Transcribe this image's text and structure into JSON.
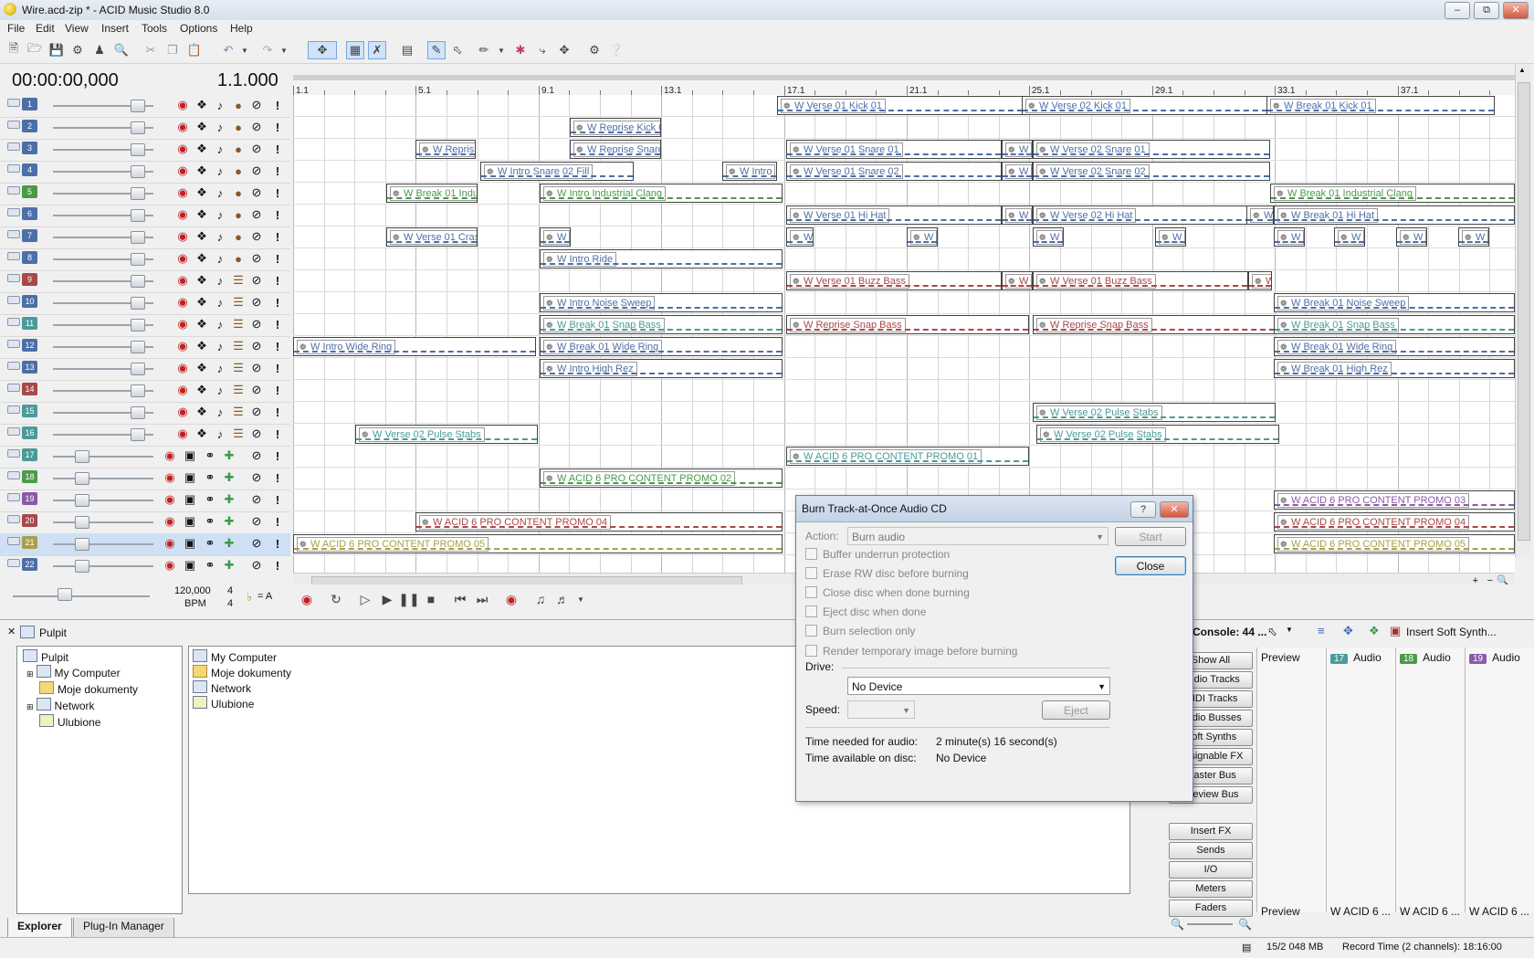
{
  "window": {
    "title": "Wire.acd-zip * - ACID Music Studio 8.0",
    "controls": [
      "–",
      "⧉",
      "✕"
    ]
  },
  "menu": [
    "File",
    "Edit",
    "View",
    "Insert",
    "Tools",
    "Options",
    "Help"
  ],
  "time": {
    "timecode": "00:00:00,000",
    "measure": "1.1.000"
  },
  "ruler": [
    "1.1",
    "5.1",
    "9.1",
    "13.1",
    "17.1",
    "21.1",
    "25.1",
    "29.1",
    "33.1",
    "37.1"
  ],
  "tracks": [
    {
      "num": "1",
      "color": "#4c6fa8"
    },
    {
      "num": "2",
      "color": "#4c6fa8"
    },
    {
      "num": "3",
      "color": "#4c6fa8"
    },
    {
      "num": "4",
      "color": "#4c6fa8"
    },
    {
      "num": "5",
      "color": "#4a9a4a"
    },
    {
      "num": "6",
      "color": "#4c6fa8"
    },
    {
      "num": "7",
      "color": "#4c6fa8"
    },
    {
      "num": "8",
      "color": "#4c6fa8"
    },
    {
      "num": "9",
      "color": "#a84848"
    },
    {
      "num": "10",
      "color": "#4c6fa8"
    },
    {
      "num": "11",
      "color": "#4a9a9a"
    },
    {
      "num": "12",
      "color": "#4c6fa8"
    },
    {
      "num": "13",
      "color": "#4c6fa8"
    },
    {
      "num": "14",
      "color": "#a84848"
    },
    {
      "num": "15",
      "color": "#4a9a9a"
    },
    {
      "num": "16",
      "color": "#4a9a9a"
    },
    {
      "num": "17",
      "color": "#4a9a9a"
    },
    {
      "num": "18",
      "color": "#4a9a4a"
    },
    {
      "num": "19",
      "color": "#8a5aa8"
    },
    {
      "num": "20",
      "color": "#a84848"
    },
    {
      "num": "21",
      "color": "#a8a048"
    },
    {
      "num": "22",
      "color": "#4c6fa8"
    }
  ],
  "clips": [
    {
      "row": 0,
      "label": "W Verse 01 Kick 01",
      "color": "#4c6fa8"
    },
    {
      "row": 0,
      "label": "W Verse 02 Kick 01",
      "color": "#4c6fa8"
    },
    {
      "row": 0,
      "label": "W Break 01 Kick 01",
      "color": "#4c6fa8"
    },
    {
      "row": 1,
      "label": "W Reprise Kick 0",
      "color": "#4c6fa8"
    },
    {
      "row": 2,
      "label": "W Repris",
      "color": "#4c6fa8"
    },
    {
      "row": 2,
      "label": "W Reprise Snare",
      "color": "#4c6fa8"
    },
    {
      "row": 2,
      "label": "W Verse 01 Snare 01",
      "color": "#4c6fa8"
    },
    {
      "row": 2,
      "label": "W",
      "color": "#4c6fa8"
    },
    {
      "row": 2,
      "label": "W Verse 02 Snare 01",
      "color": "#4c6fa8"
    },
    {
      "row": 3,
      "label": "W Intro Snare 02 Fill",
      "color": "#4c6fa8"
    },
    {
      "row": 3,
      "label": "W Intro",
      "color": "#4c6fa8"
    },
    {
      "row": 3,
      "label": "W Verse 01 Snare 02",
      "color": "#4c6fa8"
    },
    {
      "row": 3,
      "label": "W",
      "color": "#4c6fa8"
    },
    {
      "row": 3,
      "label": "W Verse 02 Snare 02",
      "color": "#4c6fa8"
    },
    {
      "row": 4,
      "label": "W Break 01 Indu",
      "color": "#4a9a4a"
    },
    {
      "row": 4,
      "label": "W Intro Industrial Clang",
      "color": "#4a9a4a"
    },
    {
      "row": 4,
      "label": "W Break 01 Industrial Clang",
      "color": "#4a9a4a"
    },
    {
      "row": 5,
      "label": "W Verse 01 Hi Hat",
      "color": "#4c6fa8"
    },
    {
      "row": 5,
      "label": "W",
      "color": "#4c6fa8"
    },
    {
      "row": 5,
      "label": "W Verse 02 Hi Hat",
      "color": "#4c6fa8"
    },
    {
      "row": 5,
      "label": "W",
      "color": "#4c6fa8"
    },
    {
      "row": 5,
      "label": "W Break 01 Hi Hat",
      "color": "#4c6fa8"
    },
    {
      "row": 6,
      "label": "W Verse 01 Cras",
      "color": "#4c6fa8"
    },
    {
      "row": 6,
      "label": "W",
      "color": "#4c6fa8"
    },
    {
      "row": 6,
      "label": "W",
      "color": "#4c6fa8"
    },
    {
      "row": 6,
      "label": "W",
      "color": "#4c6fa8"
    },
    {
      "row": 6,
      "label": "W",
      "color": "#4c6fa8"
    },
    {
      "row": 6,
      "label": "W",
      "color": "#4c6fa8"
    },
    {
      "row": 6,
      "label": "W",
      "color": "#4c6fa8"
    },
    {
      "row": 6,
      "label": "W",
      "color": "#4c6fa8"
    },
    {
      "row": 6,
      "label": "W",
      "color": "#4c6fa8"
    },
    {
      "row": 6,
      "label": "W",
      "color": "#4c6fa8"
    },
    {
      "row": 7,
      "label": "W Intro Ride",
      "color": "#4c6fa8"
    },
    {
      "row": 8,
      "label": "W Verse 01 Buzz Bass",
      "color": "#a84848"
    },
    {
      "row": 8,
      "label": "W",
      "color": "#a84848"
    },
    {
      "row": 8,
      "label": "W Verse 01 Buzz Bass",
      "color": "#a84848"
    },
    {
      "row": 8,
      "label": "W",
      "color": "#a84848"
    },
    {
      "row": 9,
      "label": "W Intro Noise Sweep",
      "color": "#4c6fa8"
    },
    {
      "row": 9,
      "label": "W Break 01 Noise Sweep",
      "color": "#4c6fa8"
    },
    {
      "row": 10,
      "label": "W Break 01 Snap Bass",
      "color": "#4a9a9a"
    },
    {
      "row": 10,
      "label": "W Reprise Snap Bass",
      "color": "#a84848"
    },
    {
      "row": 10,
      "label": "W Reprise Snap Bass",
      "color": "#a84848"
    },
    {
      "row": 10,
      "label": "W Break 01 Snap Bass",
      "color": "#4a9a9a"
    },
    {
      "row": 11,
      "label": "W Intro Wide Ring",
      "color": "#4c6fa8"
    },
    {
      "row": 11,
      "label": "W Break 01 Wide Ring",
      "color": "#4c6fa8"
    },
    {
      "row": 11,
      "label": "W Break 01 Wide Ring",
      "color": "#4c6fa8"
    },
    {
      "row": 12,
      "label": "W Intro High Rez",
      "color": "#4c6fa8"
    },
    {
      "row": 12,
      "label": "W Break 01 High Rez",
      "color": "#4c6fa8"
    },
    {
      "row": 14,
      "label": "W Verse 02 Pulse Stabs",
      "color": "#4a9a9a"
    },
    {
      "row": 15,
      "label": "W Verse 02 Pulse Stabs",
      "color": "#4a9a9a"
    },
    {
      "row": 15,
      "label": "W Verse 02 Pulse Stabs",
      "color": "#4a9a9a"
    },
    {
      "row": 16,
      "label": "W ACID 6 PRO CONTENT PROMO 01",
      "color": "#4a9a9a"
    },
    {
      "row": 17,
      "label": "W ACID 6 PRO CONTENT PROMO 02",
      "color": "#4a9a4a"
    },
    {
      "row": 18,
      "label": "W ACID 6 PRO CONTENT PROMO 03",
      "color": "#8a5aa8"
    },
    {
      "row": 19,
      "label": "W ACID 6 PRO CONTENT PROMO 04",
      "color": "#a84848"
    },
    {
      "row": 19,
      "label": "W ACID 6 PRO CONTENT PROMO 04",
      "color": "#a84848"
    },
    {
      "row": 20,
      "label": "W ACID 6 PRO CONTENT PROMO 05",
      "color": "#a8a048"
    },
    {
      "row": 20,
      "label": "W ACID 6 PRO CONTENT PROMO 05",
      "color": "#a8a048"
    }
  ],
  "master": {
    "tempo": "120,000",
    "bpm_label": "BPM",
    "sig_top": "4",
    "sig_bottom": "4",
    "key": "= A"
  },
  "explorer": {
    "path": "Pulpit",
    "tree": [
      "Pulpit",
      "My Computer",
      "Moje dokumenty",
      "Network",
      "Ulubione"
    ],
    "files": [
      "My Computer",
      "Moje dokumenty",
      "Network",
      "Ulubione"
    ],
    "tabs": [
      "Explorer",
      "Plug-In Manager"
    ]
  },
  "mixer": {
    "title": "Console: 44 ...",
    "insert_synth": "Insert Soft Synth...",
    "buttons_top": [
      "Show All",
      "Audio Tracks",
      "MIDI Tracks",
      "Audio Busses",
      "Soft Synths",
      "Assignable FX",
      "Master Bus",
      "Preview Bus"
    ],
    "buttons_bottom": [
      "Insert FX",
      "Sends",
      "I/O",
      "Meters",
      "Faders"
    ],
    "preview": "Preview",
    "channels": [
      {
        "num": "17",
        "label": "Audio",
        "footer": "W ACID 6 ...",
        "color": "#4a9a9a"
      },
      {
        "num": "18",
        "label": "Audio",
        "footer": "W ACID 6 ...",
        "color": "#4a9a4a"
      },
      {
        "num": "19",
        "label": "Audio",
        "footer": "W ACID 6 ...",
        "color": "#8a5aa8"
      }
    ]
  },
  "dialog": {
    "title": "Burn Track-at-Once Audio CD",
    "action_label": "Action:",
    "action_value": "Burn audio",
    "start": "Start",
    "close": "Close",
    "checkboxes": [
      "Buffer underrun protection",
      "Erase RW disc before burning",
      "Close disc when done burning",
      "Eject disc when done",
      "Burn selection only",
      "Render temporary image before burning"
    ],
    "drive_label": "Drive:",
    "drive_value": "No Device",
    "speed_label": "Speed:",
    "eject": "Eject",
    "time_needed_label": "Time needed for audio:",
    "time_needed_value": "2 minute(s) 16 second(s)",
    "time_available_label": "Time available on disc:",
    "time_available_value": "No Device"
  },
  "status": {
    "disk": "15/2 048 MB",
    "record_time": "Record Time (2 channels): 18:16:00"
  }
}
